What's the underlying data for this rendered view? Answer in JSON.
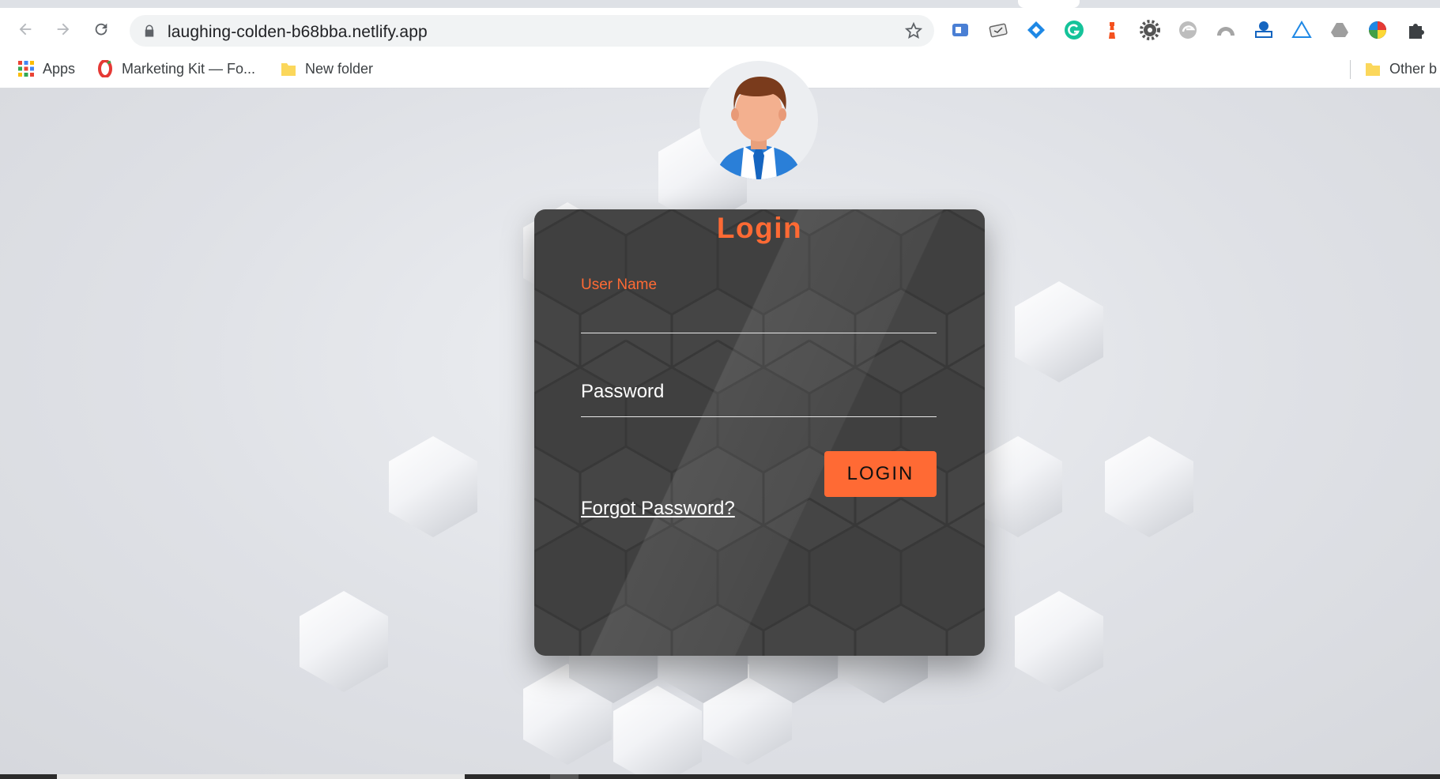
{
  "browser": {
    "url": "laughing-colden-b68bba.netlify.app",
    "extensions": [
      "read-aloud-icon",
      "clipboard-icon",
      "diamond-icon",
      "grammarly-icon",
      "lighthouse-icon",
      "gear-icon",
      "edge-icon",
      "rainbow-icon",
      "translate-icon",
      "triangle-icon",
      "drive-icon",
      "color-wheel-icon",
      "puzzle-icon"
    ]
  },
  "bookmarks": {
    "items": [
      {
        "label": "Apps",
        "icon": "apps-grid-icon"
      },
      {
        "label": "Marketing Kit — Fo...",
        "icon": "marketing-kit-icon"
      },
      {
        "label": "New folder",
        "icon": "folder-icon"
      }
    ],
    "other_label": "Other b"
  },
  "login": {
    "title": "Login",
    "username_label": "User Name",
    "password_label": "Password",
    "button_label": "LOGIN",
    "forgot_label": "Forgot Password?"
  },
  "colors": {
    "accent": "#ff6a34",
    "card": "#454545",
    "background": "#dfe1e6"
  }
}
